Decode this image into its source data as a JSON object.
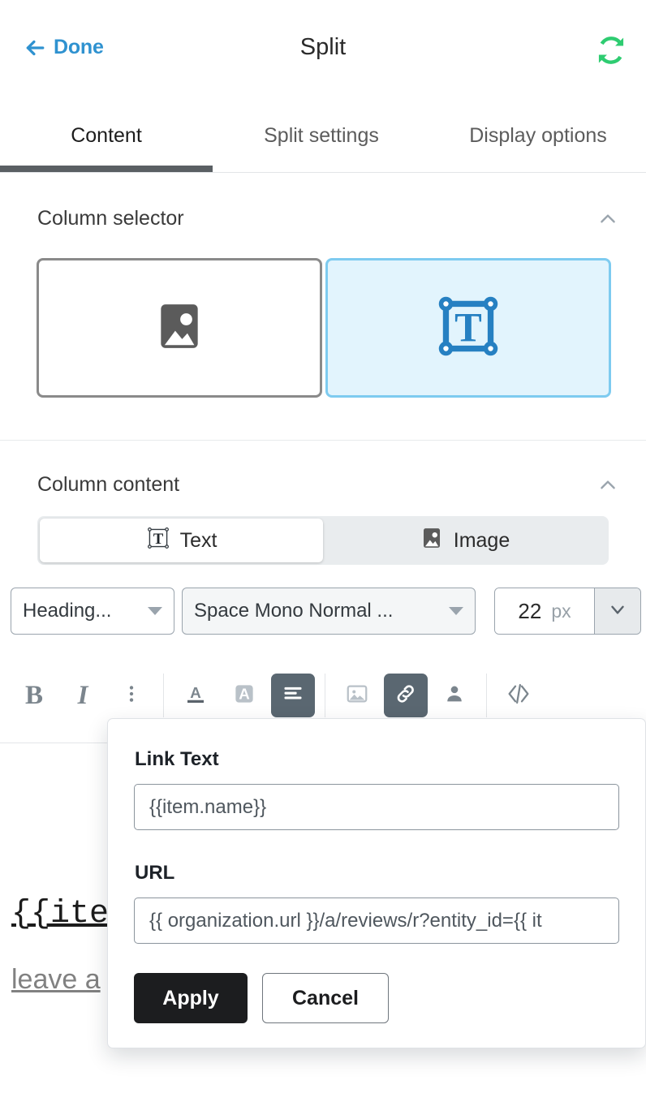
{
  "header": {
    "back_label": "Done",
    "back_icon": "arrow-left-icon",
    "title": "Split",
    "sync_icon": "refresh-sync-icon",
    "accent_blue": "#2f92d0",
    "sync_green": "#2ecc71"
  },
  "tabs": [
    {
      "label": "Content",
      "active": true
    },
    {
      "label": "Split settings",
      "active": false
    },
    {
      "label": "Display options",
      "active": false
    }
  ],
  "column_selector": {
    "title": "Column selector",
    "collapse_icon": "chevron-up-icon",
    "tiles": [
      {
        "icon": "image-placeholder-icon",
        "selected": false
      },
      {
        "icon": "text-box-icon",
        "selected": true
      }
    ],
    "selected_bg": "#e2f4fd",
    "selected_border": "#7ecbf0",
    "selected_icon_color": "#2680c2"
  },
  "column_content": {
    "title": "Column content",
    "collapse_icon": "chevron-up-icon",
    "segmented": [
      {
        "label": "Text",
        "icon": "text-box-icon",
        "active": true
      },
      {
        "label": "Image",
        "icon": "image-placeholder-icon",
        "active": false
      }
    ],
    "style_dropdown": {
      "value": "Heading...",
      "caret_icon": "caret-down-icon"
    },
    "font_dropdown": {
      "value": "Space Mono Normal ...",
      "caret_icon": "caret-down-icon"
    },
    "font_size": {
      "value": "22",
      "unit": "px",
      "stepper_icon": "chevron-down-icon"
    }
  },
  "toolbar": [
    {
      "name": "bold",
      "glyph": "B",
      "active": false
    },
    {
      "name": "italic",
      "glyph": "I",
      "active": false
    },
    {
      "name": "more-options",
      "glyph": "kebab-menu-icon",
      "active": false
    },
    {
      "name": "text-color",
      "glyph": "text-color-icon",
      "active": false
    },
    {
      "name": "highlight-color",
      "glyph": "highlight-icon",
      "active": false
    },
    {
      "name": "align",
      "glyph": "align-left-icon",
      "active": true
    },
    {
      "name": "insert-image",
      "glyph": "image-icon",
      "active": false
    },
    {
      "name": "insert-link",
      "glyph": "link-icon",
      "active": true
    },
    {
      "name": "insert-person",
      "glyph": "person-icon",
      "active": false
    },
    {
      "name": "source-code",
      "glyph": "code-icon",
      "active": false
    }
  ],
  "canvas": {
    "line1": "{{ite",
    "line2": "leave a"
  },
  "link_dialog": {
    "link_text_label": "Link Text",
    "link_text_value": "{{item.name}}",
    "url_label": "URL",
    "url_value": "{{ organization.url }}/a/reviews/r?entity_id={{ it",
    "apply_label": "Apply",
    "cancel_label": "Cancel"
  }
}
